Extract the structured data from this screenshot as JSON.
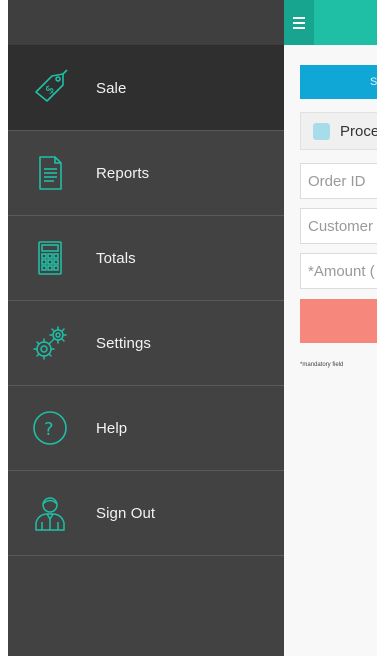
{
  "drawer": {
    "items": [
      {
        "label": "Sale",
        "icon": "sale-tag-icon",
        "active": true
      },
      {
        "label": "Reports",
        "icon": "report-document-icon",
        "active": false
      },
      {
        "label": "Totals",
        "icon": "calculator-icon",
        "active": false
      },
      {
        "label": "Settings",
        "icon": "gears-icon",
        "active": false
      },
      {
        "label": "Help",
        "icon": "help-question-icon",
        "active": false
      },
      {
        "label": "Sign Out",
        "icon": "user-sign-out-icon",
        "active": false
      }
    ]
  },
  "content": {
    "blue_button_label": "S",
    "checkbox_label": "Proce",
    "fields": {
      "order_id_placeholder": "Order ID",
      "customer_placeholder": "Customer",
      "amount_placeholder": "*Amount ("
    },
    "mandatory_note": "*mandatory field"
  },
  "colors": {
    "drawer_bg": "#424242",
    "active_item_bg": "#2f2f2f",
    "icon_teal": "#1fbfa6",
    "topbar": "#1fbfa6",
    "blue_button": "#10a7d7",
    "coral_button": "#f6877c"
  }
}
